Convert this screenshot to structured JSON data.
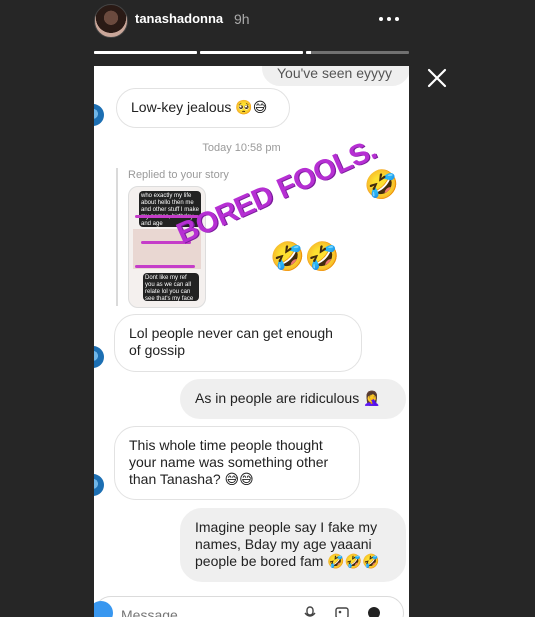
{
  "story_header": {
    "username": "tanashadonna",
    "time_ago": "9h",
    "progress_segments": [
      1,
      1,
      0.05
    ]
  },
  "messages": {
    "top_partial": "You've seen eyyyy",
    "jealous": "Low-key jealous 🥺😅",
    "timestamp": "Today 10:58 pm",
    "replied_label": "Replied to your story",
    "story_thumb_top": "who exactly my life about hello then me and other stuff I make my names, birthday and age",
    "story_thumb_bottom": "Dont like my ref you as we can all relate lol you can see that's my face",
    "sticker_text": "BORED FOOLS.",
    "sticker_emoji_1": "🤣",
    "sticker_emoji_2": "🤣🤣",
    "gossip": "Lol people never can get enough of gossip",
    "ridiculous": "As in people are ridiculous 🤦‍♀️",
    "whole_time": "This whole time people thought your name was something other than Tanasha? 😅😅",
    "imagine": "Imagine people say I fake my names, Bday my age yaaani people be bored fam 🤣🤣🤣"
  },
  "composer": {
    "placeholder": "Message..."
  }
}
